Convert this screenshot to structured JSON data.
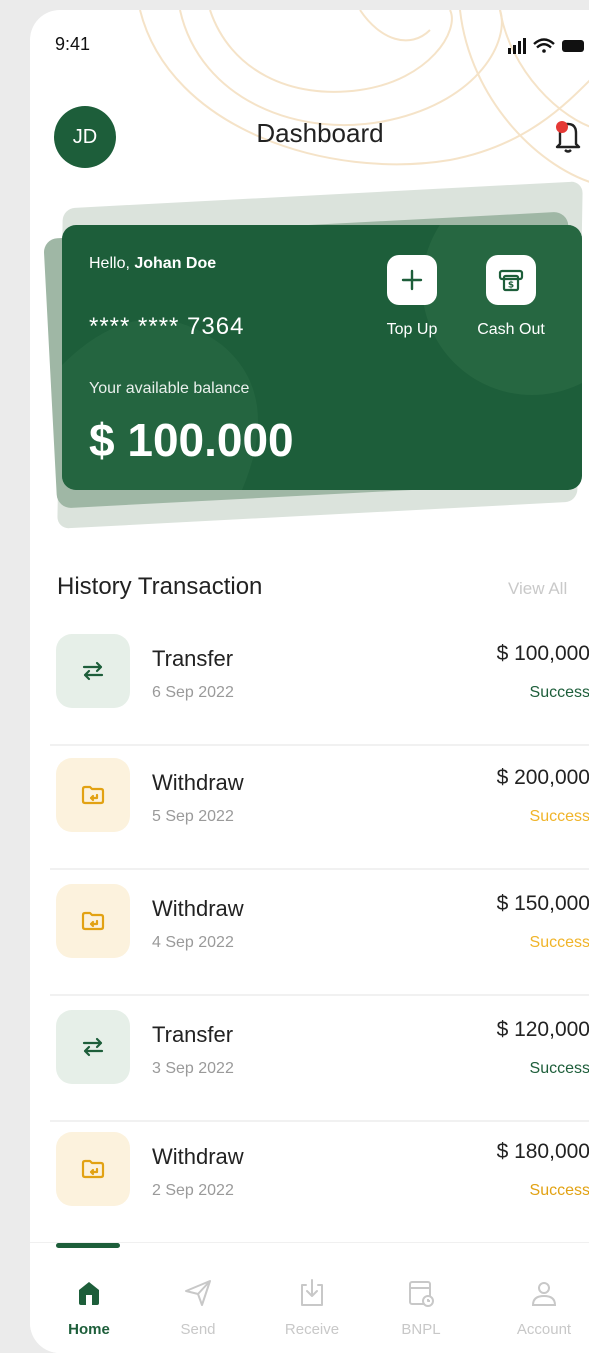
{
  "status": {
    "time": "9:41"
  },
  "header": {
    "avatar_initials": "JD",
    "title": "Dashboard"
  },
  "card": {
    "greeting": "Hello, ",
    "user_name": "Johan Doe",
    "card_number": "**** **** 7364",
    "balance_label": "Your available balance",
    "balance": "$ 100.000",
    "actions": [
      {
        "label": "Top Up",
        "icon": "plus-icon"
      },
      {
        "label": "Cash Out",
        "icon": "cash-out-icon"
      }
    ]
  },
  "history": {
    "title": "History Transaction",
    "view_all": "View All",
    "items": [
      {
        "name": "Transfer",
        "date": "6 Sep 2022",
        "amount": "$ 100,000",
        "status": "Success",
        "type": "transfer",
        "status_color": "#1d5e3a"
      },
      {
        "name": "Withdraw",
        "date": "5 Sep 2022",
        "amount": "$ 200,000",
        "status": "Success",
        "type": "withdraw",
        "status_color": "#f0b429"
      },
      {
        "name": "Withdraw",
        "date": "4 Sep 2022",
        "amount": "$ 150,000",
        "status": "Success",
        "type": "withdraw",
        "status_color": "#f0b429"
      },
      {
        "name": "Transfer",
        "date": "3 Sep 2022",
        "amount": "$ 120,000",
        "status": "Success",
        "type": "transfer",
        "status_color": "#1d5e3a"
      },
      {
        "name": "Withdraw",
        "date": "2 Sep 2022",
        "amount": "$ 180,000",
        "status": "Success",
        "type": "withdraw",
        "status_color": "#e2a213"
      }
    ]
  },
  "tabs": [
    {
      "label": "Home",
      "icon": "home-icon",
      "active": true
    },
    {
      "label": "Send",
      "icon": "send-icon",
      "active": false
    },
    {
      "label": "Receive",
      "icon": "receive-icon",
      "active": false
    },
    {
      "label": "BNPL",
      "icon": "bnpl-icon",
      "active": false
    },
    {
      "label": "Account",
      "icon": "account-icon",
      "active": false
    }
  ],
  "colors": {
    "primary": "#1d5e3a",
    "warning": "#f0b429",
    "muted": "#c8c8c8"
  }
}
